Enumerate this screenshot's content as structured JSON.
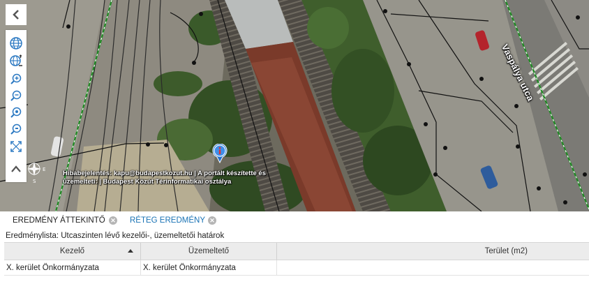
{
  "map": {
    "street_label": "Vaspálya utca",
    "attribution_line1": "Hibabejelentés: kapu@budapestkozut.hu | A portált készítette és",
    "attribution_line2": "üzemelteti: | Budapest Közút Térinformatikai osztálya",
    "compass": {
      "north": "N",
      "south": "S",
      "east": "E",
      "west": "W"
    },
    "tools": [
      "globe-icon",
      "globe-pan-icon",
      "zoom-in-icon",
      "zoom-out-icon",
      "zoom-in-alt-icon",
      "zoom-out-alt-icon",
      "full-extent-icon",
      "chevron-up-icon"
    ],
    "colors": {
      "boundary": "#1e8a22",
      "rail": "#2b2b2b",
      "roof": "#7a3a2a"
    }
  },
  "panel": {
    "tabs": [
      {
        "label": "EREDMÉNY ÁTTEKINTŐ",
        "active": false
      },
      {
        "label": "RÉTEG EREDMÉNY",
        "active": true
      }
    ],
    "title": "Eredménylista: Utcaszinten lévő kezelői-, üzemeltetői határok",
    "columns": [
      "Kezelő",
      "Üzemeltető",
      "Terület (m2)"
    ],
    "rows": [
      [
        "X. kerület Önkormányzata",
        "X. kerület Önkormányzata",
        ""
      ]
    ],
    "accent": "#1a73b5"
  }
}
